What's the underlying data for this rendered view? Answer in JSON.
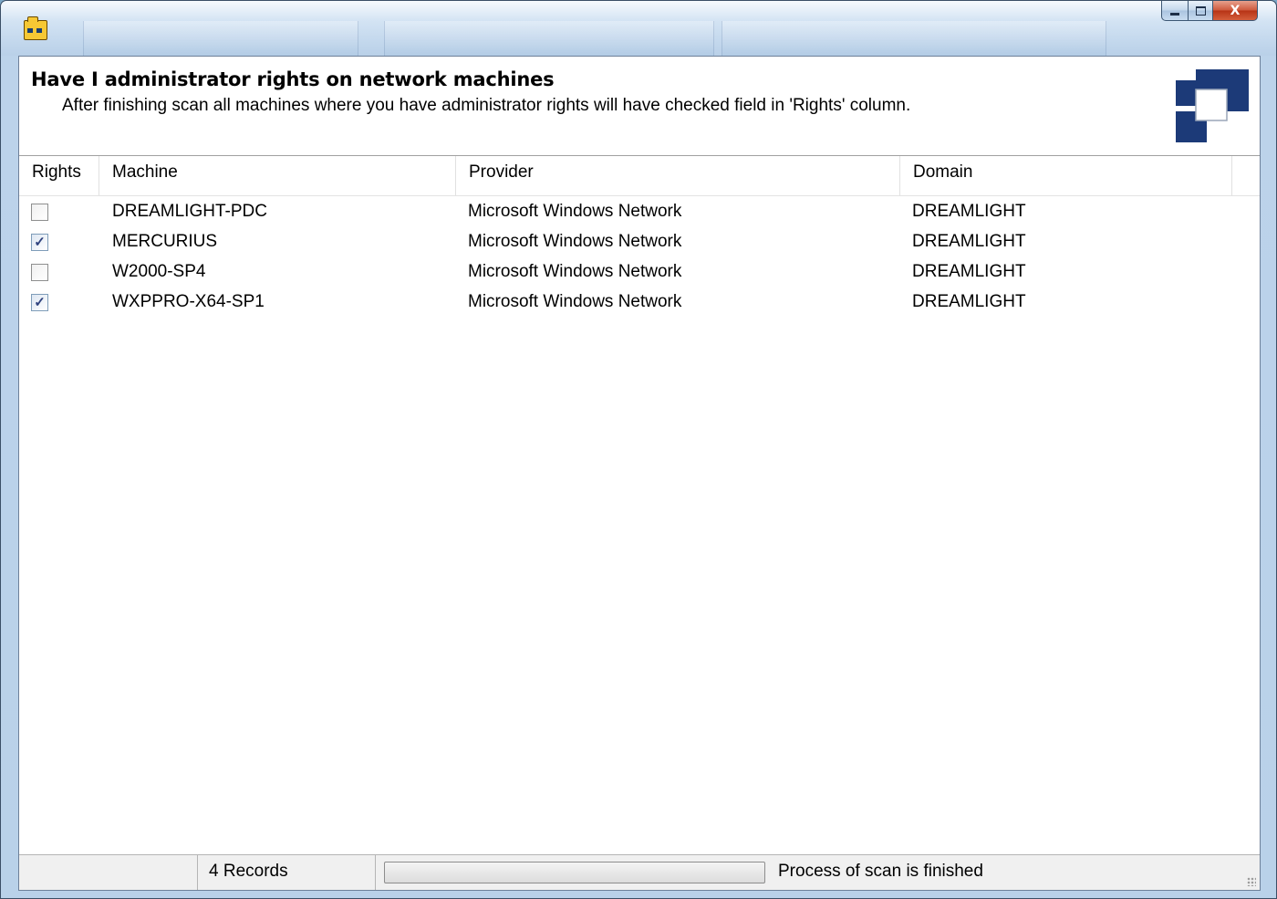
{
  "window": {
    "title": "",
    "icon": "network-folder-icon",
    "controls": {
      "minimize": "minimize-icon",
      "maximize": "maximize-icon",
      "close": "X"
    }
  },
  "header": {
    "title": "Have I administrator rights on network machines",
    "description": "After finishing scan all machines where you have administrator rights will have checked field in 'Rights' column.",
    "logo": "puzzle-logo"
  },
  "grid": {
    "columns": [
      "Rights",
      "Machine",
      "Provider",
      "Domain"
    ],
    "rows": [
      {
        "rights": false,
        "machine": "DREAMLIGHT-PDC",
        "provider": "Microsoft Windows Network",
        "domain": "DREAMLIGHT"
      },
      {
        "rights": true,
        "machine": "MERCURIUS",
        "provider": "Microsoft Windows Network",
        "domain": "DREAMLIGHT"
      },
      {
        "rights": false,
        "machine": "W2000-SP4",
        "provider": "Microsoft Windows Network",
        "domain": "DREAMLIGHT"
      },
      {
        "rights": true,
        "machine": "WXPPRO-X64-SP1",
        "provider": "Microsoft Windows Network",
        "domain": "DREAMLIGHT"
      }
    ]
  },
  "status": {
    "records": "4 Records",
    "progress": 0,
    "message": "Process of scan is finished"
  },
  "colors": {
    "logo_blue": "#1c3a78",
    "checkbox_tick": "#30437e",
    "close_button": "#c7452a"
  }
}
